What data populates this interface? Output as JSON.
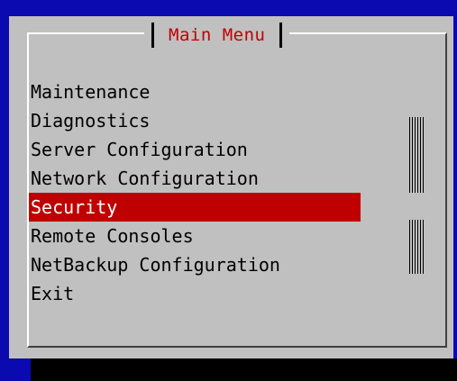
{
  "dialog": {
    "title": "Main Menu"
  },
  "menu": {
    "items": [
      {
        "label": "Maintenance"
      },
      {
        "label": "Diagnostics"
      },
      {
        "label": "Server Configuration"
      },
      {
        "label": "Network Configuration"
      },
      {
        "label": "Security",
        "selected": true
      },
      {
        "label": "Remote Consoles"
      },
      {
        "label": "NetBackup Configuration"
      },
      {
        "label": "Exit"
      }
    ]
  },
  "colors": {
    "background": "#0a0ab0",
    "dialog": "#c0c0c0",
    "title": "#c00000",
    "highlight": "#c00000",
    "highlight_text": "#ffffff"
  }
}
